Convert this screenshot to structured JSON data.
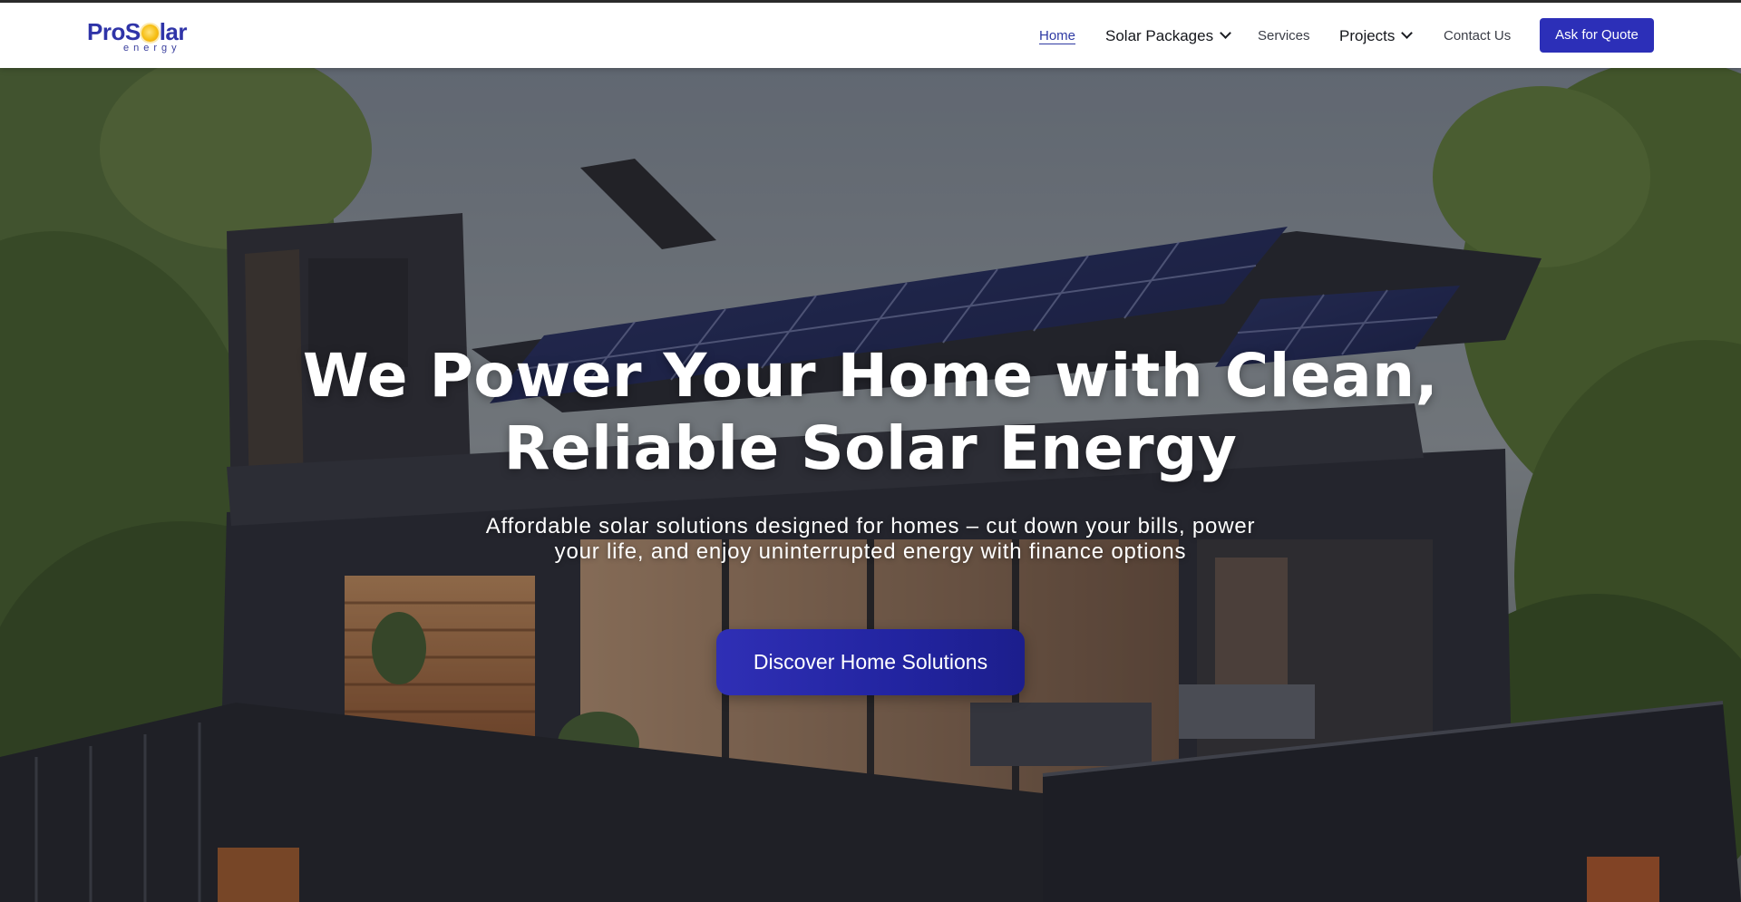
{
  "brand": {
    "logo_word_left": "ProS",
    "logo_word_right": "lar",
    "logo_sub": "energy",
    "colors": {
      "primary": "#2c2fb8",
      "logo_blue": "#2f34a8",
      "sun": "#f6bf14",
      "active_link": "#2f3aa3"
    }
  },
  "nav": {
    "home": "Home",
    "solar_packages": "Solar Packages",
    "services": "Services",
    "projects": "Projects",
    "contact": "Contact Us",
    "quote_button": "Ask for Quote",
    "active_item": "Home"
  },
  "hero": {
    "title_line1": "We Power Your Home with Clean,",
    "title_line2": "Reliable Solar Energy",
    "subtitle_line1": "Affordable solar solutions designed for homes – cut down your bills, power",
    "subtitle_line2": "your life, and enjoy uninterrupted energy with finance options",
    "cta_button": "Discover Home Solutions"
  }
}
